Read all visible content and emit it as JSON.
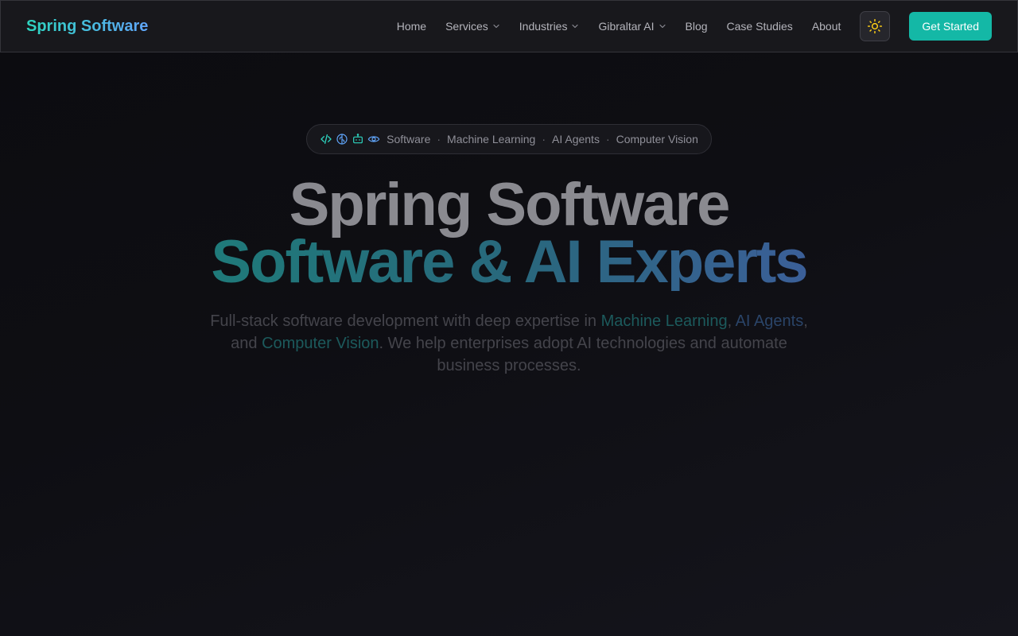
{
  "brand": {
    "logo_text": "Spring Software"
  },
  "nav": {
    "items": [
      {
        "label": "Home",
        "has_dropdown": false
      },
      {
        "label": "Services",
        "has_dropdown": true
      },
      {
        "label": "Industries",
        "has_dropdown": true
      },
      {
        "label": "Gibraltar AI",
        "has_dropdown": true
      },
      {
        "label": "Blog",
        "has_dropdown": false
      },
      {
        "label": "Case Studies",
        "has_dropdown": false
      },
      {
        "label": "About",
        "has_dropdown": false
      }
    ],
    "theme_toggle_icon": "sun-icon",
    "cta_label": "Get Started"
  },
  "hero": {
    "pill": {
      "icons": [
        "code-icon",
        "brain-icon",
        "bot-icon",
        "eye-icon"
      ],
      "topics": [
        "Software",
        "Machine Learning",
        "AI Agents",
        "Computer Vision"
      ],
      "separator": "·"
    },
    "title_line1": "Spring Software",
    "title_line2": "Software & AI Experts",
    "subtitle": {
      "part1": "Full-stack software development with deep expertise in ",
      "hl1": "Machine Learning",
      "part2": ", ",
      "hl2": "AI Agents",
      "part3": ", and ",
      "hl3": "Computer Vision",
      "part4": ". We help enterprises adopt AI technologies and automate business processes."
    }
  },
  "colors": {
    "accent": "#14b8a6",
    "accent_blue": "#60a5fa",
    "sun": "#facc15",
    "background": "#0e0e13"
  }
}
